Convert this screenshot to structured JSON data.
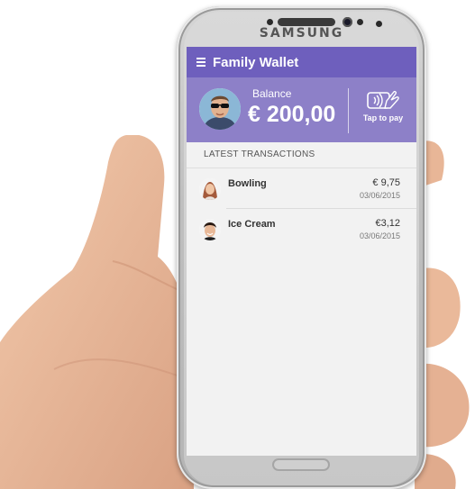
{
  "device": {
    "brand": "SAMSUNG"
  },
  "app": {
    "title": "Family Wallet"
  },
  "balance": {
    "label": "Balance",
    "amount": "€ 200,00",
    "tap_to_pay_label": "Tap to pay"
  },
  "transactions": {
    "section_title": "LATEST TRANSACTIONS",
    "items": [
      {
        "name": "Bowling",
        "amount": "€ 9,75",
        "date": "03/06/2015"
      },
      {
        "name": "Ice Cream",
        "amount": "€3,12",
        "date": "03/06/2015"
      }
    ]
  },
  "colors": {
    "accent": "#6e5fbd",
    "panel": "#8d80c8",
    "background": "#f2f2f2"
  },
  "icons": [
    "menu-icon",
    "contactless-pay-icon",
    "avatar"
  ]
}
